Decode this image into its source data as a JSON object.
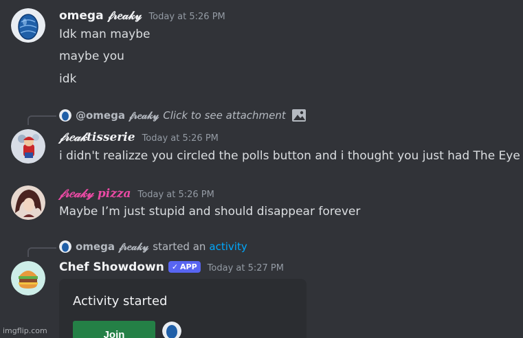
{
  "messages": [
    {
      "username": "omega 𝒻𝓇𝑒𝒶𝓀𝓎",
      "timestamp": "Today at 5:26 PM",
      "lines": [
        "Idk man maybe",
        "maybe you",
        "idk"
      ]
    },
    {
      "reply": {
        "username": "@omega 𝒻𝓇𝑒𝒶𝓀𝓎",
        "text": "Click to see attachment"
      },
      "username": "𝒻𝓇𝑒𝒶𝓀tisserie",
      "timestamp": "Today at 5:26 PM",
      "text": "i didn't realizze you circled the polls button and i thought you just had The Eye"
    },
    {
      "username": "𝒻𝓇𝑒𝒶𝓀𝓎 pizza",
      "timestamp": "Today at 5:26 PM",
      "text": "Maybe I’m just stupid and should disappear forever"
    },
    {
      "interaction": {
        "username": "omega 𝒻𝓇𝑒𝒶𝓀𝓎",
        "action": "started an",
        "link": "activity"
      },
      "username": "Chef Showdown",
      "badge": "APP",
      "timestamp": "Today at 5:27 PM",
      "card": {
        "title": "Activity started",
        "join_label": "Join"
      }
    }
  ],
  "watermark": "imgflip.com",
  "colors": {
    "background": "#313338",
    "pink_username": "#ea4aa4",
    "link": "#00a8fc",
    "join_button": "#248046",
    "app_badge": "#5865f2"
  }
}
